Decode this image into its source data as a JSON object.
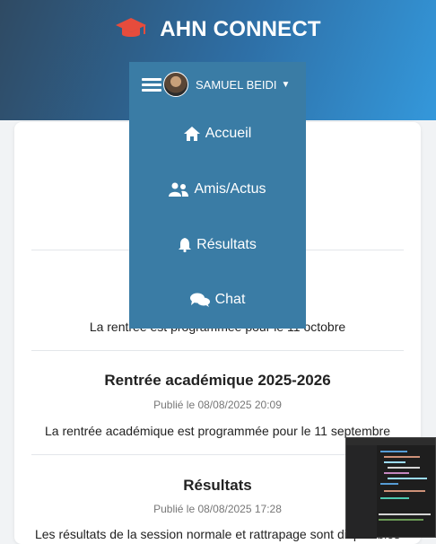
{
  "header": {
    "app_name": "AHN CONNECT",
    "logo_icon": "graduation-cap-icon",
    "background_color": "#2e6fa6"
  },
  "user_menu": {
    "user_name": "SAMUEL BEIDI",
    "items": [
      {
        "label": "Accueil",
        "icon": "home-icon"
      },
      {
        "label": "Amis/Actus",
        "icon": "users-icon"
      },
      {
        "label": "Résultats",
        "icon": "bell-icon"
      },
      {
        "label": "Chat",
        "icon": "chat-icon"
      }
    ],
    "background_color": "#3a7ca5"
  },
  "news": [
    {
      "text": "La rentrée est programmée pour le 11 octobre"
    },
    {
      "title": "Rentrée académique 2025-2026",
      "date": "Publié le 08/08/2025 20:09",
      "text": "La rentrée académique est programmée pour le 11 septembre"
    },
    {
      "title": "Résultats",
      "date": "Publié le 08/08/2025 17:28",
      "text": "Les résultats de la session normale et rattrapage sont disponibles"
    }
  ]
}
